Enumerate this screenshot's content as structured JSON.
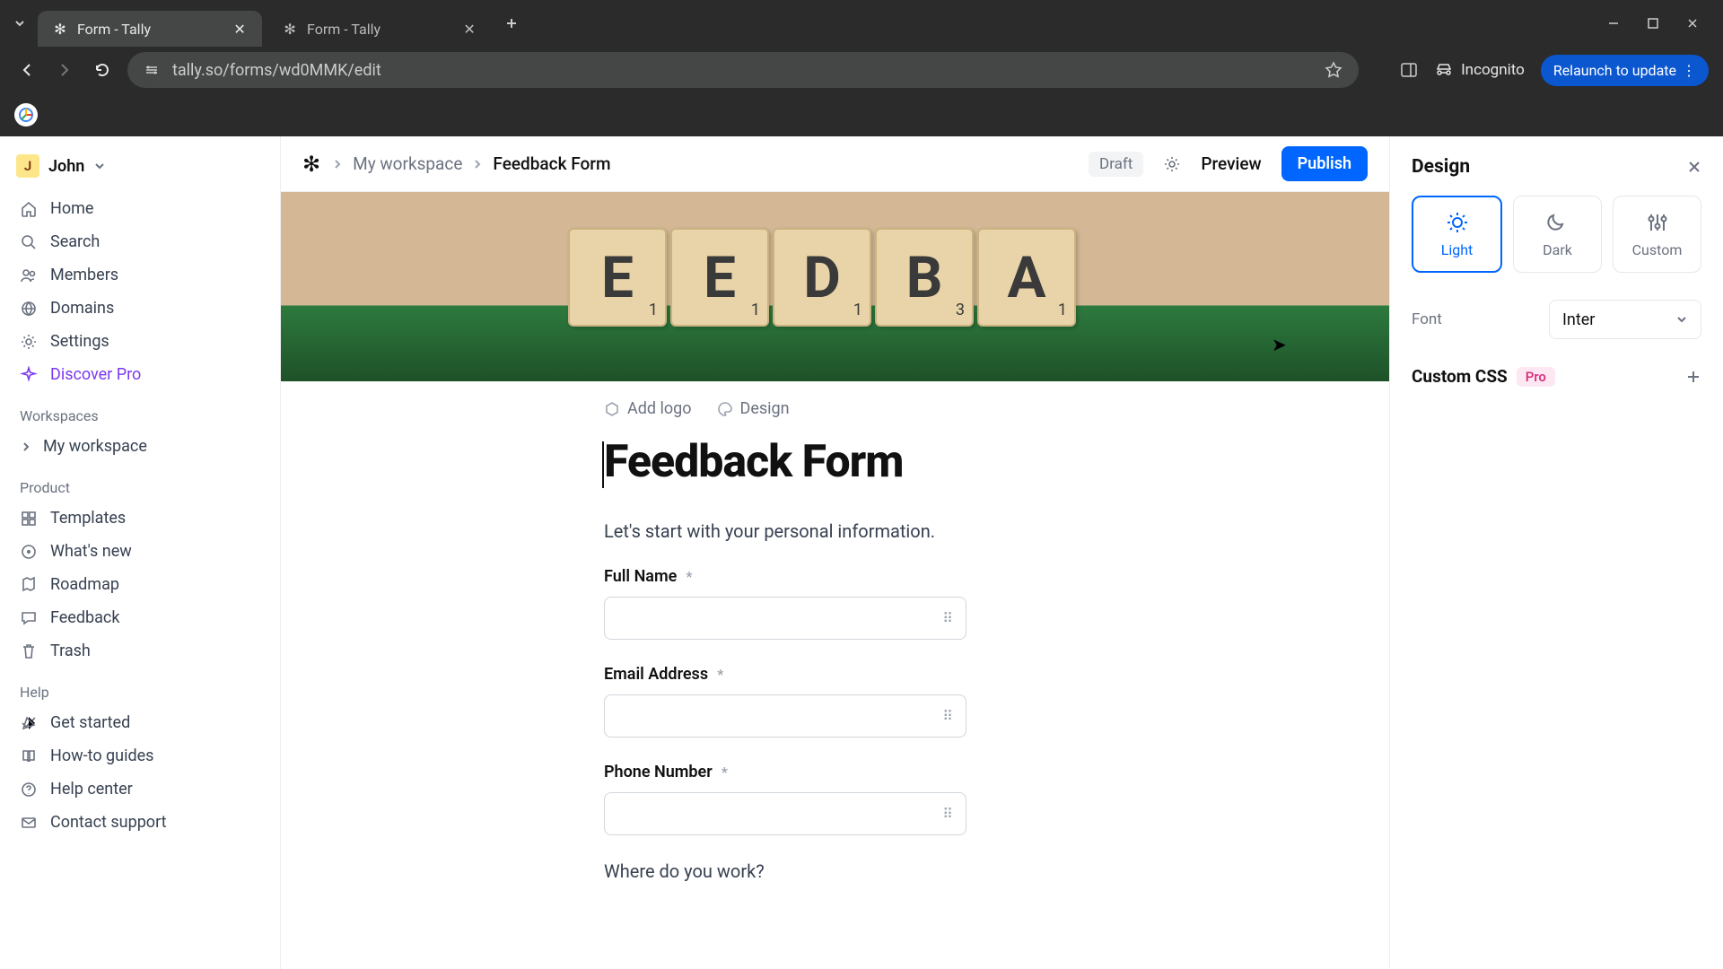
{
  "browser": {
    "tabs": [
      {
        "title": "Form - Tally",
        "active": true
      },
      {
        "title": "Form - Tally",
        "active": false
      }
    ],
    "url": "tally.so/forms/wd0MMK/edit",
    "incognito_label": "Incognito",
    "relaunch_label": "Relaunch to update"
  },
  "sidebar": {
    "user": {
      "initial": "J",
      "name": "John"
    },
    "nav": [
      {
        "icon": "home",
        "label": "Home"
      },
      {
        "icon": "search",
        "label": "Search"
      },
      {
        "icon": "members",
        "label": "Members"
      },
      {
        "icon": "domains",
        "label": "Domains"
      },
      {
        "icon": "settings",
        "label": "Settings"
      },
      {
        "icon": "sparkle",
        "label": "Discover Pro",
        "pro": true
      }
    ],
    "workspaces_label": "Workspaces",
    "workspace_name": "My workspace",
    "product_label": "Product",
    "product": [
      {
        "icon": "templates",
        "label": "Templates"
      },
      {
        "icon": "whatsnew",
        "label": "What's new"
      },
      {
        "icon": "roadmap",
        "label": "Roadmap"
      },
      {
        "icon": "feedback",
        "label": "Feedback"
      },
      {
        "icon": "trash",
        "label": "Trash"
      }
    ],
    "help_label": "Help",
    "help": [
      {
        "icon": "getstarted",
        "label": "Get started"
      },
      {
        "icon": "howto",
        "label": "How-to guides"
      },
      {
        "icon": "helpcenter",
        "label": "Help center"
      },
      {
        "icon": "contact",
        "label": "Contact support"
      }
    ]
  },
  "topbar": {
    "crumb1": "My workspace",
    "crumb2": "Feedback Form",
    "draft": "Draft",
    "preview": "Preview",
    "publish": "Publish"
  },
  "form": {
    "meta_logo": "Add logo",
    "meta_design": "Design",
    "title": "Feedback Form",
    "intro": "Let's start with your personal information.",
    "fields": [
      {
        "label": "Full Name",
        "required": true
      },
      {
        "label": "Email Address",
        "required": true
      },
      {
        "label": "Phone Number",
        "required": true
      }
    ],
    "question": "Where do you work?"
  },
  "design_panel": {
    "title": "Design",
    "themes": [
      {
        "name": "Light",
        "selected": true
      },
      {
        "name": "Dark",
        "selected": false
      },
      {
        "name": "Custom",
        "selected": false
      }
    ],
    "font_label": "Font",
    "font_value": "Inter",
    "css_label": "Custom CSS",
    "pro_badge": "Pro"
  },
  "cover_tiles": [
    "E",
    "E",
    "D",
    "B",
    "A"
  ]
}
